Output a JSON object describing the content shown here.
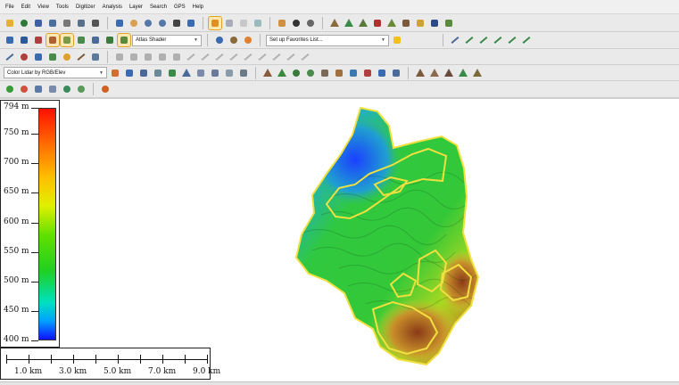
{
  "menu": [
    "File",
    "Edit",
    "View",
    "Tools",
    "Digitizer",
    "Analysis",
    "Layer",
    "Search",
    "GPS",
    "Help"
  ],
  "toolbar": {
    "shader_select": "Atlas Shader",
    "favorites_select": "Set up Favorites List...",
    "layer_style_select": "Color Lidar by RGB/Elev"
  },
  "elevation_legend": {
    "labels": [
      "794 m",
      "750 m",
      "700 m",
      "650 m",
      "600 m",
      "550 m",
      "500 m",
      "450 m",
      "400 m"
    ],
    "values": [
      794,
      750,
      700,
      650,
      600,
      550,
      500,
      450,
      400
    ]
  },
  "scale_bar": {
    "labels": [
      "1.0 km",
      "3.0 km",
      "5.0 km",
      "7.0 km",
      "9.0 km"
    ]
  },
  "map": {
    "boundary_color": "#f0e040",
    "colors": {
      "low": "#1a3cff",
      "mid": "#2fc03a",
      "high": "#c0501a"
    }
  }
}
